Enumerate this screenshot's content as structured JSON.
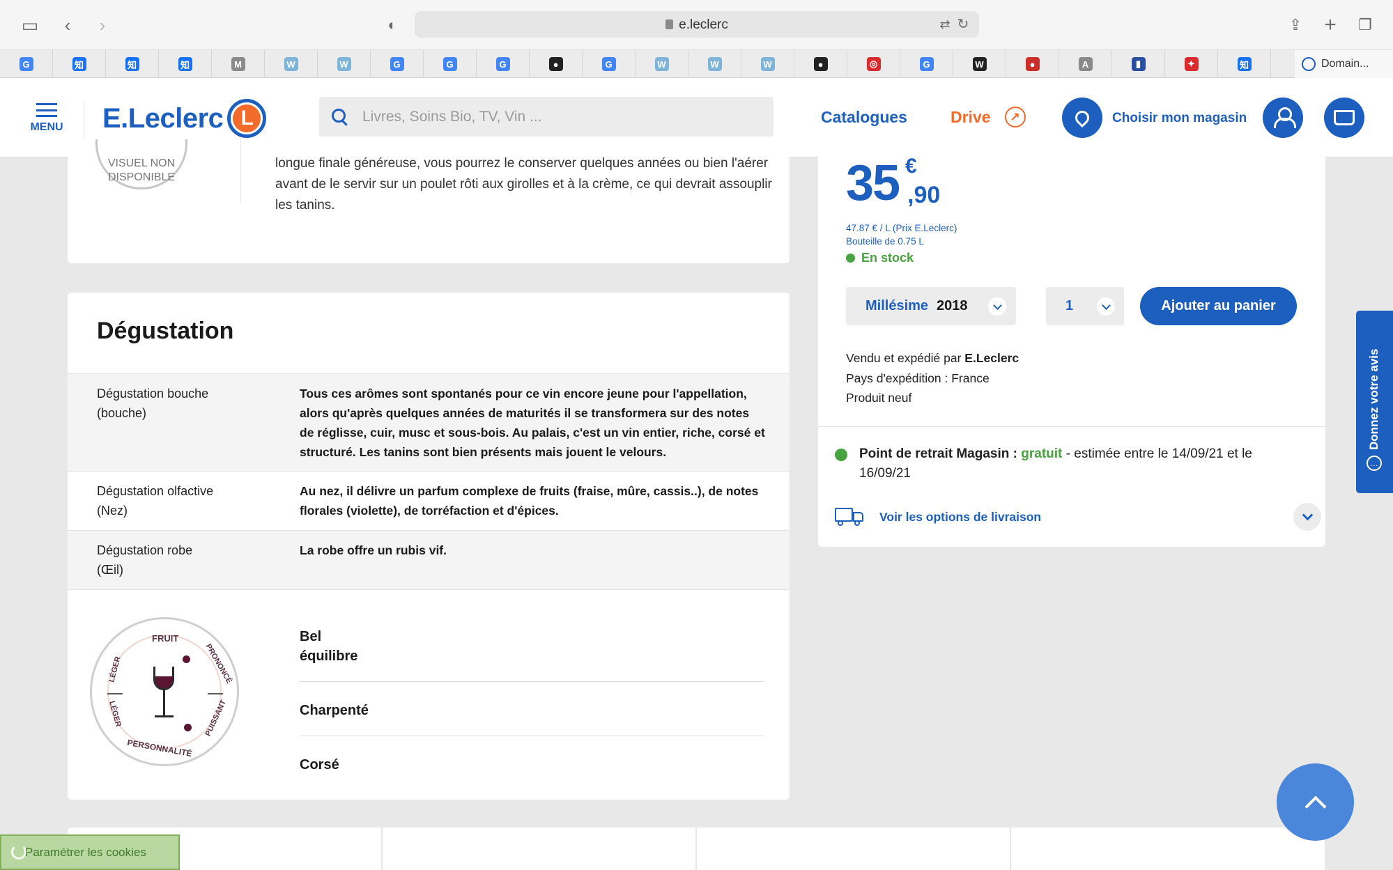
{
  "browser": {
    "url": "e.leclerc",
    "bookmarks": [
      {
        "icon": "google-icon",
        "glyph": "G",
        "color": "#4285f4"
      },
      {
        "icon": "zhihu-icon",
        "glyph": "知",
        "color": "#1772f6"
      },
      {
        "icon": "zhihu-icon",
        "glyph": "知",
        "color": "#1772f6"
      },
      {
        "icon": "zhihu-icon",
        "glyph": "知",
        "color": "#1772f6"
      },
      {
        "icon": "m-icon",
        "glyph": "M",
        "color": "#8a8a8a"
      },
      {
        "icon": "w-icon",
        "glyph": "W",
        "color": "#7fb4d9"
      },
      {
        "icon": "w-icon",
        "glyph": "W",
        "color": "#7fb4d9"
      },
      {
        "icon": "google-icon",
        "glyph": "G",
        "color": "#4285f4"
      },
      {
        "icon": "google-icon",
        "glyph": "G",
        "color": "#4285f4"
      },
      {
        "icon": "google-icon",
        "glyph": "G",
        "color": "#4285f4"
      },
      {
        "icon": "dark-circle-icon",
        "glyph": "●",
        "color": "#222222"
      },
      {
        "icon": "google-icon",
        "glyph": "G",
        "color": "#4285f4"
      },
      {
        "icon": "w-icon",
        "glyph": "W",
        "color": "#7fb4d9"
      },
      {
        "icon": "w-icon",
        "glyph": "W",
        "color": "#7fb4d9"
      },
      {
        "icon": "w-icon",
        "glyph": "W",
        "color": "#7fb4d9"
      },
      {
        "icon": "dark-circle-icon",
        "glyph": "●",
        "color": "#222222"
      },
      {
        "icon": "red-spiral-icon",
        "glyph": "◎",
        "color": "#d92b2b"
      },
      {
        "icon": "google-icon",
        "glyph": "G",
        "color": "#4285f4"
      },
      {
        "icon": "wikipedia-icon",
        "glyph": "W",
        "color": "#222222"
      },
      {
        "icon": "red-bubble-icon",
        "glyph": "●",
        "color": "#c9302c"
      },
      {
        "icon": "a-icon",
        "glyph": "A",
        "color": "#8a8a8a"
      },
      {
        "icon": "flag-icon",
        "glyph": "▮",
        "color": "#2a4fa0"
      },
      {
        "icon": "red-logo-icon",
        "glyph": "✦",
        "color": "#d92b2b"
      },
      {
        "icon": "zhihu-icon",
        "glyph": "知",
        "color": "#1772f6"
      }
    ],
    "last_tab": "Domain..."
  },
  "header": {
    "menu_label": "MENU",
    "logo_text": "E.Leclerc",
    "logo_letter": "L",
    "search_placeholder": "Livres, Soins Bio, TV, Vin ...",
    "catalogues": "Catalogues",
    "drive": "Drive",
    "store": "Choisir mon magasin"
  },
  "product": {
    "no_visual": "VISUEL NON DISPONIBLE",
    "description_tail": "longue finale généreuse, vous pourrez le conserver quelques années ou bien l'aérer avant de le servir sur un poulet rôti aux girolles et à la crème, ce qui devrait assouplir les tanins."
  },
  "degustation": {
    "title": "Dégustation",
    "rows": [
      {
        "label": "Dégustation bouche (bouche)",
        "value": "Tous ces arômes sont spontanés pour ce vin encore jeune pour l'appellation, alors qu'après quelques années de maturités il se transformera sur des notes de réglisse, cuir, musc et sous-bois. Au palais, c'est un vin entier, riche, corsé et structuré. Les tanins sont bien présents mais jouent le velours."
      },
      {
        "label": "Dégustation olfactive (Nez)",
        "value": "Au nez, il délivre un parfum complexe de fruits (fraise, mûre, cassis..), de notes florales (violette), de torréfaction et d'épices."
      },
      {
        "label": "Dégustation robe (Œil)",
        "value": "La robe offre un rubis vif."
      }
    ],
    "wheel": {
      "fruit": "FRUIT",
      "prononce": "PRONONCÉ",
      "leger_top": "LÉGER",
      "leger_bottom": "LÉGER",
      "puissant": "PUISSANT",
      "personnalite": "PERSONNALITÉ"
    },
    "profile": [
      "Bel\néquilibre",
      "Charpenté",
      "Corsé"
    ]
  },
  "purchase": {
    "price_int": "35",
    "price_currency": "€",
    "price_dec": ",90",
    "price_per_litre": "47.87 € / L (Prix E.Leclerc)",
    "bottle": "Bouteille de 0.75 L",
    "stock": "En stock",
    "millesime_label": "Millésime",
    "millesime_value": "2018",
    "quantity": "1",
    "add_to_cart": "Ajouter au panier",
    "seller_prefix": "Vendu et expédié par ",
    "seller_name": "E.Leclerc",
    "country": "Pays d'expédition : France",
    "condition": "Produit neuf",
    "retrait_label": "Point de retrait Magasin :",
    "retrait_free": "gratuit",
    "retrait_text": " - estimée entre le 14/09/21 et le 16/09/21",
    "delivery_options": "Voir les options de livraison"
  },
  "feedback_tab": "Donnez votre avis",
  "cookies": "Paramétrer les cookies",
  "colors": {
    "brand": "#1d5fbf",
    "accent": "#f26b2b",
    "stock": "#47a23f"
  }
}
